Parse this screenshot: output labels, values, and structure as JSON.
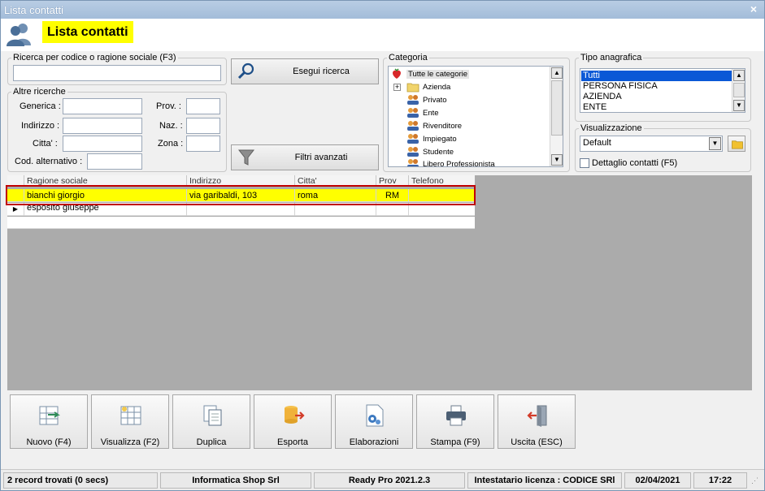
{
  "window": {
    "title": "Lista contatti",
    "close_glyph": "×"
  },
  "header": {
    "title": "Lista contatti",
    "icon": "user-contacts-icon"
  },
  "search": {
    "legend": "Ricerca per codice o ragione sociale (F3)",
    "value": "",
    "button_label": "Esegui ricerca"
  },
  "altre": {
    "legend": "Altre ricerche",
    "generica_label": "Generica :",
    "indirizzo_label": "Indirizzo :",
    "citta_label": "Citta' :",
    "cod_alt_label": "Cod. alternativo :",
    "prov_label": "Prov. :",
    "naz_label": "Naz. :",
    "zona_label": "Zona :",
    "filtri_label": "Filtri avanzati"
  },
  "categoria": {
    "legend": "Categoria",
    "root": "Tutte le categorie",
    "items": [
      "Azienda",
      "Privato",
      "Ente",
      "Rivenditore",
      "Impiegato",
      "Studente",
      "Libero Professionista"
    ]
  },
  "tipo": {
    "legend": "Tipo anagrafica",
    "items": [
      "Tutti",
      "PERSONA FISICA",
      "AZIENDA",
      "ENTE"
    ]
  },
  "visualizzazione": {
    "legend": "Visualizzazione",
    "selected": "Default",
    "dettaglio_label": "Dettaglio contatti (F5)"
  },
  "grid": {
    "columns": [
      "Ragione sociale",
      "Indirizzo",
      "Citta'",
      "Prov",
      "Telefono"
    ],
    "rows": [
      {
        "ragione": "bianchi giorgio",
        "indirizzo": "via garibaldi, 103",
        "citta": "roma",
        "prov": "RM",
        "telefono": ""
      },
      {
        "ragione": "esposito giuseppe",
        "indirizzo": "",
        "citta": "",
        "prov": "",
        "telefono": ""
      }
    ]
  },
  "toolbar": {
    "nuovo": "Nuovo (F4)",
    "visualizza": "Visualizza (F2)",
    "duplica": "Duplica",
    "esporta": "Esporta",
    "elaborazioni": "Elaborazioni",
    "stampa": "Stampa (F9)",
    "uscita": "Uscita (ESC)"
  },
  "status": {
    "records": "2 record trovati (0 secs)",
    "company": "Informatica Shop Srl",
    "version": "Ready Pro 2021.2.3",
    "license": "Intestatario licenza : CODICE SRl",
    "date": "02/04/2021",
    "time": "17:22"
  },
  "colors": {
    "highlight": "#ffff00",
    "selection": "#0a58d6",
    "outline": "#c00000"
  }
}
